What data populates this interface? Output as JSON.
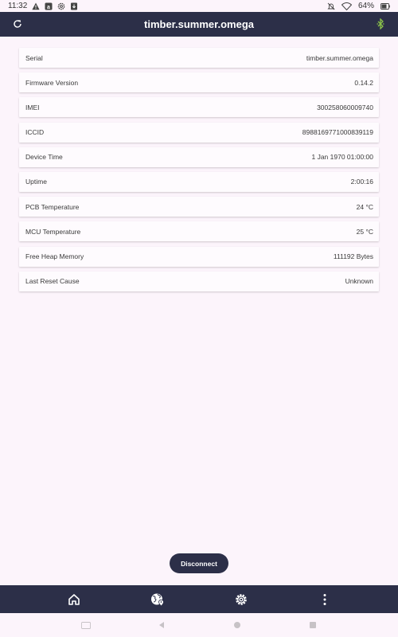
{
  "status_bar": {
    "time": "11:32",
    "battery": "64%",
    "left_icons": [
      "warning-icon",
      "app-a-icon",
      "settings-icon",
      "download-icon"
    ],
    "right_icons": [
      "mute-icon",
      "wifi-icon",
      "battery-icon"
    ]
  },
  "app_bar": {
    "title": "timber.summer.omega",
    "left_icon": "refresh-icon",
    "right_icon": "bluetooth-icon",
    "accent": "#2c2f48",
    "bluetooth_color": "#8bc34a"
  },
  "info_rows": [
    {
      "label": "Serial",
      "value": "timber.summer.omega"
    },
    {
      "label": "Firmware Version",
      "value": "0.14.2"
    },
    {
      "label": "IMEI",
      "value": "300258060009740"
    },
    {
      "label": "ICCID",
      "value": "8988169771000839119"
    },
    {
      "label": "Device Time",
      "value": "1 Jan 1970 01:00:00"
    },
    {
      "label": "Uptime",
      "value": "2:00:16"
    },
    {
      "label": "PCB Temperature",
      "value": "24 °C"
    },
    {
      "label": "MCU Temperature",
      "value": "25 °C"
    },
    {
      "label": "Free Heap Memory",
      "value": "111192 Bytes"
    },
    {
      "label": "Last Reset Cause",
      "value": "Unknown"
    }
  ],
  "disconnect_label": "Disconnect",
  "bottom_nav": [
    "home-icon",
    "globe-location-icon",
    "settings-icon",
    "more-vertical-icon"
  ],
  "system_nav": [
    "keyboard-icon",
    "back-icon",
    "home-circle-icon",
    "recents-icon"
  ],
  "colors": {
    "background": "#fcf4fb",
    "bar": "#2c2f48"
  }
}
